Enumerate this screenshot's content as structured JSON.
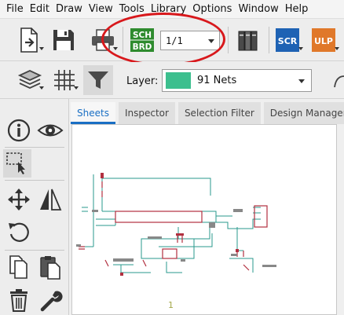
{
  "menu": [
    "File",
    "Edit",
    "Draw",
    "View",
    "Tools",
    "Library",
    "Options",
    "Window",
    "Help"
  ],
  "toolbar": {
    "schbrd_top": "SCH",
    "schbrd_bottom": "BRD",
    "sheet_value": "1/1",
    "scr_label": "SCR",
    "ulp_label": "ULP"
  },
  "layer": {
    "label": "Layer:",
    "name": "91 Nets",
    "swatch_color": "#3cbf8e"
  },
  "tabs": [
    "Sheets",
    "Inspector",
    "Selection Filter",
    "Design Manager"
  ],
  "active_tab": "Sheets",
  "sheet": {
    "number": "1"
  },
  "colors": {
    "accent": "#1a6fc4",
    "highlight_circle": "#d8181c",
    "schbrd_green": "#2e8b2e",
    "scr_blue": "#1e62b4",
    "ulp_orange": "#e0782a",
    "wire_teal": "#2a9a8c",
    "part_red": "#b23040"
  },
  "icons": [
    "open-icon",
    "save-icon",
    "print-icon",
    "schbrd-switch-icon",
    "library-icon",
    "scr-icon",
    "ulp-icon",
    "layers-icon",
    "grid-icon",
    "filter-icon",
    "info-icon",
    "show-icon",
    "select-icon",
    "move-icon",
    "mirror-icon",
    "rotate-icon",
    "copy-icon",
    "paste-icon",
    "delete-icon",
    "wrench-icon"
  ]
}
